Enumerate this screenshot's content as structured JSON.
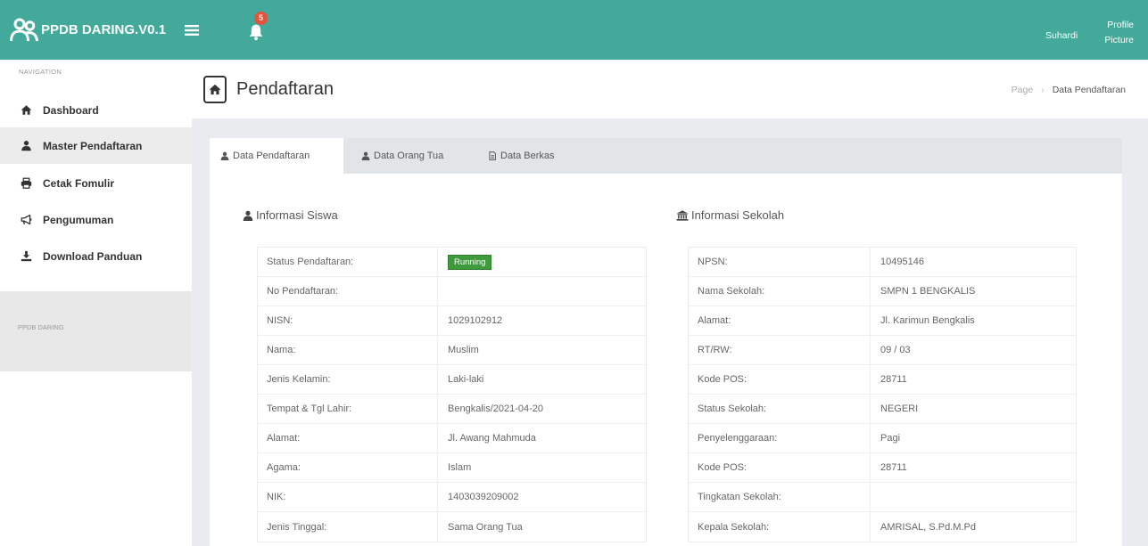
{
  "colors": {
    "topbar": "#42a99b",
    "badge": "#e8513a",
    "status_running": "#3d9b3d"
  },
  "topbar": {
    "brand": "PPDB DARING.V0.1",
    "brand_icon": "users-icon",
    "menu_icon": "hamburger-icon",
    "notification_icon": "bell-icon",
    "notification_count": "5",
    "user_name": "Suhardi",
    "profile_picture_alt": "Profile Picture"
  },
  "sidebar": {
    "header": "NAVIGATION",
    "items": [
      {
        "label": "Dashboard",
        "icon": "home-icon"
      },
      {
        "label": "Master Pendaftaran",
        "icon": "user-icon",
        "active": true
      },
      {
        "label": "Cetak Fomulir",
        "icon": "print-icon"
      },
      {
        "label": "Pengumuman",
        "icon": "bullhorn-icon"
      },
      {
        "label": "Download Panduan",
        "icon": "download-icon"
      }
    ],
    "footer": "PPDB DARING"
  },
  "page": {
    "icon": "home-icon",
    "title": "Pendaftaran",
    "breadcrumb": {
      "items": [
        "Page",
        "Data Pendaftaran"
      ],
      "separator": "›"
    }
  },
  "tabs": [
    {
      "label": "Data Pendaftaran",
      "icon": "user-icon",
      "active": true
    },
    {
      "label": "Data Orang Tua",
      "icon": "user-icon"
    },
    {
      "label": "Data Berkas",
      "icon": "file-icon"
    }
  ],
  "siswa": {
    "title": "Informasi Siswa",
    "icon": "user-icon",
    "rows": [
      {
        "label": "Status Pendaftaran:",
        "value": "Running"
      },
      {
        "label": "No Pendaftaran:",
        "value": ""
      },
      {
        "label": "NISN:",
        "value": "1029102912"
      },
      {
        "label": "Nama:",
        "value": "Muslim"
      },
      {
        "label": "Jenis Kelamin:",
        "value": "Laki-laki"
      },
      {
        "label": "Tempat & Tgl Lahir:",
        "value": "Bengkalis/2021-04-20"
      },
      {
        "label": "Alamat:",
        "value": "Jl. Awang Mahmuda"
      },
      {
        "label": "Agama:",
        "value": "Islam"
      },
      {
        "label": "NIK:",
        "value": "1403039209002"
      },
      {
        "label": "Jenis Tinggal:",
        "value": "Sama Orang Tua"
      }
    ]
  },
  "sekolah": {
    "title": "Informasi Sekolah",
    "icon": "bank-icon",
    "rows": [
      {
        "label": "NPSN:",
        "value": "10495146"
      },
      {
        "label": "Nama Sekolah:",
        "value": "SMPN 1 BENGKALIS"
      },
      {
        "label": "Alamat:",
        "value": "Jl. Karimun Bengkalis"
      },
      {
        "label": "RT/RW:",
        "value": "09 / 03"
      },
      {
        "label": "Kode POS:",
        "value": "28711"
      },
      {
        "label": "Status Sekolah:",
        "value": "NEGERI"
      },
      {
        "label": "Penyelenggaraan:",
        "value": "Pagi"
      },
      {
        "label": "Kode POS:",
        "value": "28711"
      },
      {
        "label": "Tingkatan Sekolah:",
        "value": ""
      },
      {
        "label": "Kepala Sekolah:",
        "value": "AMRISAL, S.Pd.M.Pd"
      }
    ]
  }
}
